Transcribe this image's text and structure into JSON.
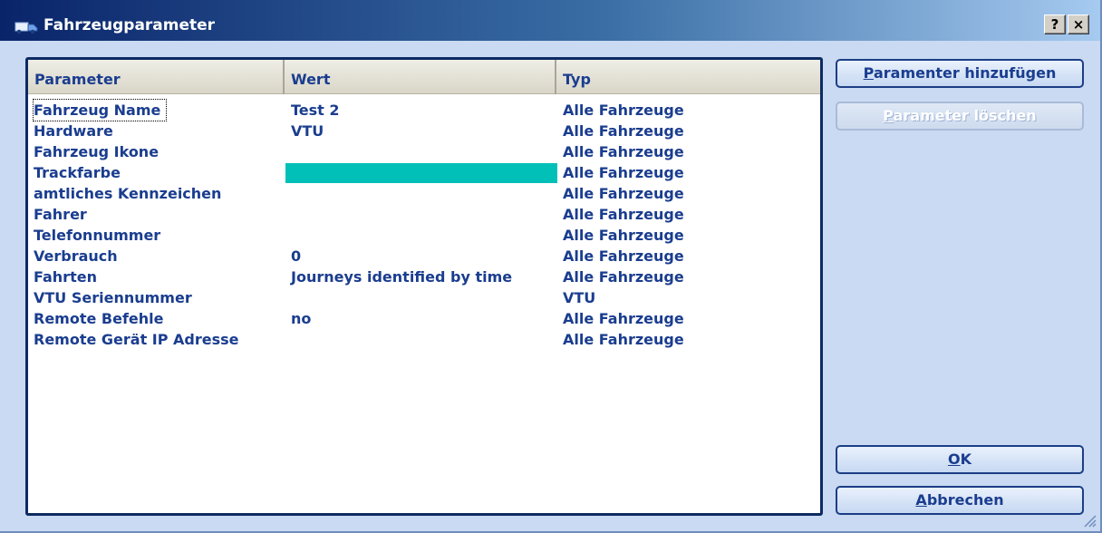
{
  "window": {
    "title": "Fahrzeugparameter",
    "help_label": "?",
    "close_label": "×"
  },
  "list": {
    "headers": {
      "parameter": "Parameter",
      "wert": "Wert",
      "typ": "Typ"
    },
    "rows": [
      {
        "parameter": "Fahrzeug Name",
        "wert": "Test 2",
        "typ": "Alle Fahrzeuge"
      },
      {
        "parameter": "Hardware",
        "wert": "VTU",
        "typ": "Alle Fahrzeuge"
      },
      {
        "parameter": "Fahrzeug Ikone",
        "wert": "",
        "typ": "Alle Fahrzeuge"
      },
      {
        "parameter": "Trackfarbe",
        "wert": "",
        "typ": "Alle Fahrzeuge",
        "color": "#00c0b8"
      },
      {
        "parameter": "amtliches Kennzeichen",
        "wert": "",
        "typ": "Alle Fahrzeuge"
      },
      {
        "parameter": "Fahrer",
        "wert": "",
        "typ": "Alle Fahrzeuge"
      },
      {
        "parameter": "Telefonnummer",
        "wert": "",
        "typ": "Alle Fahrzeuge"
      },
      {
        "parameter": "Verbrauch",
        "wert": "0",
        "typ": "Alle Fahrzeuge"
      },
      {
        "parameter": "Fahrten",
        "wert": "Journeys identified by time",
        "typ": "Alle Fahrzeuge"
      },
      {
        "parameter": "VTU Seriennummer",
        "wert": "",
        "typ": "VTU"
      },
      {
        "parameter": "Remote Befehle",
        "wert": "no",
        "typ": "Alle Fahrzeuge"
      },
      {
        "parameter": "Remote Gerät IP Adresse",
        "wert": "",
        "typ": "Alle Fahrzeuge"
      }
    ]
  },
  "buttons": {
    "add": {
      "mnemonic": "P",
      "rest": "aramenter hinzufügen"
    },
    "delete": {
      "mnemonic": "P",
      "rest": "arameter löschen"
    },
    "ok": {
      "mnemonic": "O",
      "rest": "K"
    },
    "cancel": {
      "mnemonic": "A",
      "rest": "bbrechen"
    }
  },
  "colors": {
    "accent": "#1a3d8f",
    "titlebar_start": "#0a246a",
    "titlebar_end": "#a6caf0",
    "dialog_bg": "#c9daf2",
    "trackfarbe": "#00c0b8"
  }
}
